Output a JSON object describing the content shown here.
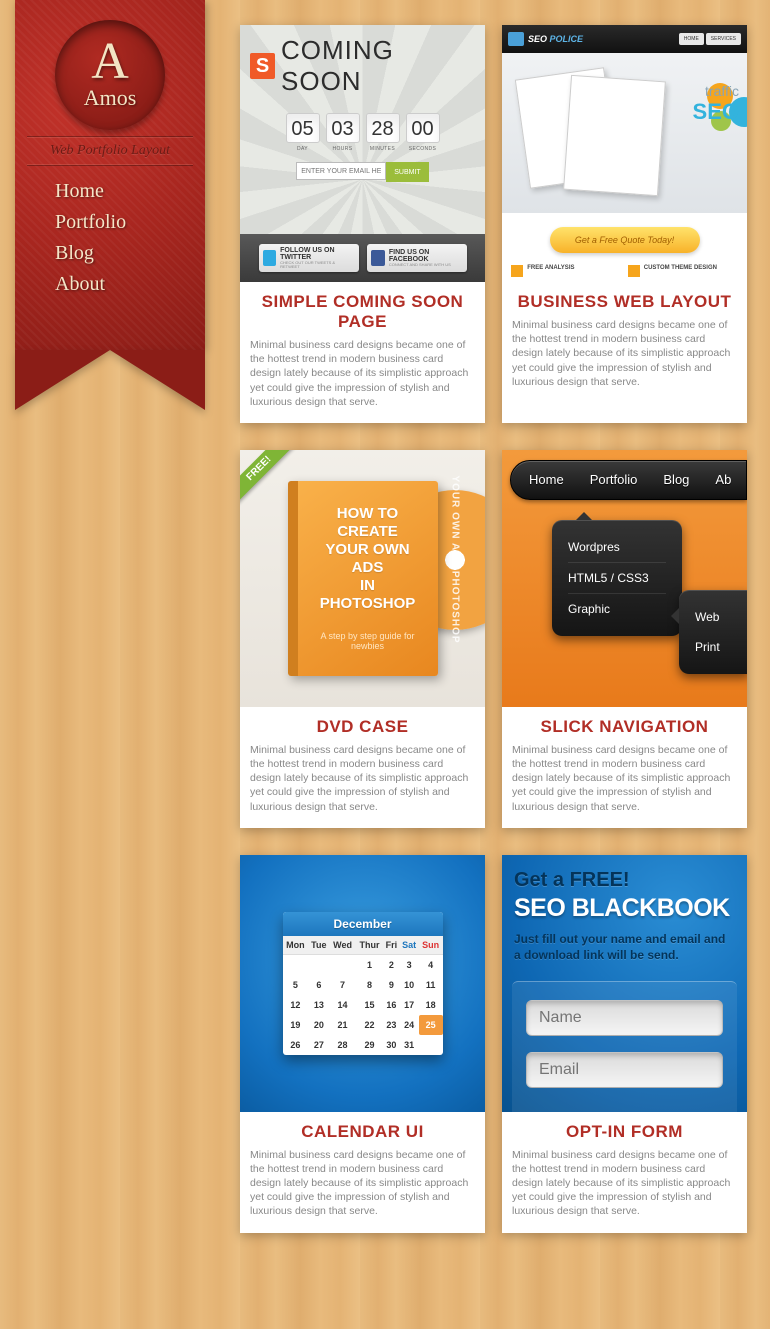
{
  "brand": {
    "initial": "A",
    "name": "Amos",
    "tagline": "Web Portfolio Layout"
  },
  "nav": [
    "Home",
    "Portfolio",
    "Blog",
    "About"
  ],
  "cards": [
    {
      "title": "SIMPLE COMING SOON PAGE",
      "desc": "Minimal business card designs became one of the hottest trend in modern business card design lately because of its simplistic approach yet could give the impression of stylish and luxurious design that serve."
    },
    {
      "title": "BUSINESS WEB LAYOUT",
      "desc": "Minimal business card designs became one of the hottest trend in modern business card design lately because of its simplistic approach yet could give the impression of stylish and luxurious design that serve."
    },
    {
      "title": "DVD CASE",
      "desc": "Minimal business card designs became one of the hottest trend in modern business card design lately because of its simplistic approach yet could give the impression of stylish and luxurious design that serve."
    },
    {
      "title": "SLICK NAVIGATION",
      "desc": "Minimal business card designs became one of the hottest trend in modern business card design lately because of its simplistic approach yet could give the impression of stylish and luxurious design that serve."
    },
    {
      "title": "CALENDAR UI",
      "desc": "Minimal business card designs became one of the hottest trend in modern business card design lately because of its simplistic approach yet could give the impression of stylish and luxurious design that serve."
    },
    {
      "title": "OPT-IN FORM",
      "desc": "Minimal business card designs became one of the hottest trend in modern business card design lately because of its simplistic approach yet could give the impression of stylish and luxurious design that serve."
    }
  ],
  "t1": {
    "badge": "S",
    "headline": "COMING SOON",
    "counters": [
      {
        "n": "05",
        "l": "DAY"
      },
      {
        "n": "03",
        "l": "HOURS"
      },
      {
        "n": "28",
        "l": "MINUTES"
      },
      {
        "n": "00",
        "l": "SECONDS"
      }
    ],
    "email_placeholder": "ENTER YOUR EMAIL HERE",
    "submit": "SUBMIT",
    "twitter": "FOLLOW US ON TWITTER",
    "twitter_sub": "CHECK OUT OUR TWEETS & RETWEET",
    "facebook": "FIND US ON FACEBOOK",
    "facebook_sub": "CONNECT AND SHARE WITH US"
  },
  "t2": {
    "logo_a": "SEO",
    "logo_b": "POLICE",
    "btn1": "HOME",
    "btn2": "SERVICES",
    "word1": "traffic",
    "word2": "SEO",
    "cta": "Get a Free Quote Today!",
    "feat1": "FREE ANALYSIS",
    "feat2": "CUSTOM THEME DESIGN"
  },
  "t3": {
    "free": "FREE!",
    "line1": "HOW TO CREATE",
    "line2": "YOUR OWN ADS",
    "line3": "IN",
    "line4": "PHOTOSHOP",
    "sub": "A step by step guide for newbies",
    "disc": "YOUR OWN ADS  PHOTOSHOP"
  },
  "t4": {
    "menu": [
      "Home",
      "Portfolio",
      "Blog",
      "Ab"
    ],
    "dd1": [
      "Wordpres",
      "HTML5 / CSS3",
      "Graphic"
    ],
    "dd2": [
      "Web",
      "Print"
    ]
  },
  "t5": {
    "month": "December",
    "dow": [
      "Mon",
      "Tue",
      "Wed",
      "Thur",
      "Fri",
      "Sat",
      "Sun"
    ],
    "weeks": [
      [
        "",
        "",
        "",
        "1",
        "2",
        "3",
        "4"
      ],
      [
        "5",
        "6",
        "7",
        "8",
        "9",
        "10",
        "11"
      ],
      [
        "12",
        "13",
        "14",
        "15",
        "16",
        "17",
        "18"
      ],
      [
        "19",
        "20",
        "21",
        "22",
        "23",
        "24",
        "25"
      ],
      [
        "26",
        "27",
        "28",
        "29",
        "30",
        "31",
        ""
      ]
    ],
    "today": "25"
  },
  "t6": {
    "l1": "Get a FREE!",
    "l2": "SEO BLACKBOOK",
    "l3": "Just fill out your name and email and a download link will be send.",
    "name_ph": "Name",
    "email_ph": "Email"
  }
}
